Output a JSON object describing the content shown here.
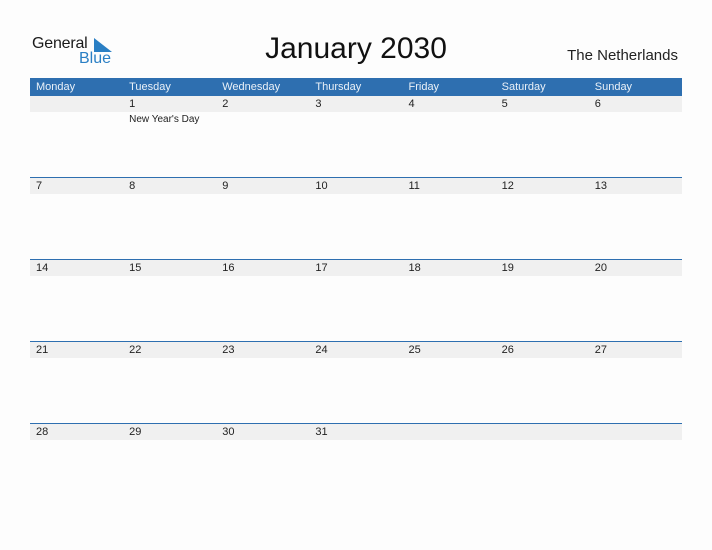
{
  "logo": {
    "line1": "General",
    "line2": "Blue"
  },
  "title": "January 2030",
  "country": "The Netherlands",
  "colors": {
    "accent": "#2e6fb0",
    "strip": "#f0f0f0",
    "logo_blue": "#2a7fc4"
  },
  "weekdays": [
    "Monday",
    "Tuesday",
    "Wednesday",
    "Thursday",
    "Friday",
    "Saturday",
    "Sunday"
  ],
  "weeks": [
    {
      "days": [
        "",
        "1",
        "2",
        "3",
        "4",
        "5",
        "6"
      ],
      "events": [
        "",
        "New Year's Day",
        "",
        "",
        "",
        "",
        ""
      ]
    },
    {
      "days": [
        "7",
        "8",
        "9",
        "10",
        "11",
        "12",
        "13"
      ],
      "events": [
        "",
        "",
        "",
        "",
        "",
        "",
        ""
      ]
    },
    {
      "days": [
        "14",
        "15",
        "16",
        "17",
        "18",
        "19",
        "20"
      ],
      "events": [
        "",
        "",
        "",
        "",
        "",
        "",
        ""
      ]
    },
    {
      "days": [
        "21",
        "22",
        "23",
        "24",
        "25",
        "26",
        "27"
      ],
      "events": [
        "",
        "",
        "",
        "",
        "",
        "",
        ""
      ]
    },
    {
      "days": [
        "28",
        "29",
        "30",
        "31",
        "",
        "",
        ""
      ],
      "events": [
        "",
        "",
        "",
        "",
        "",
        "",
        ""
      ]
    }
  ]
}
